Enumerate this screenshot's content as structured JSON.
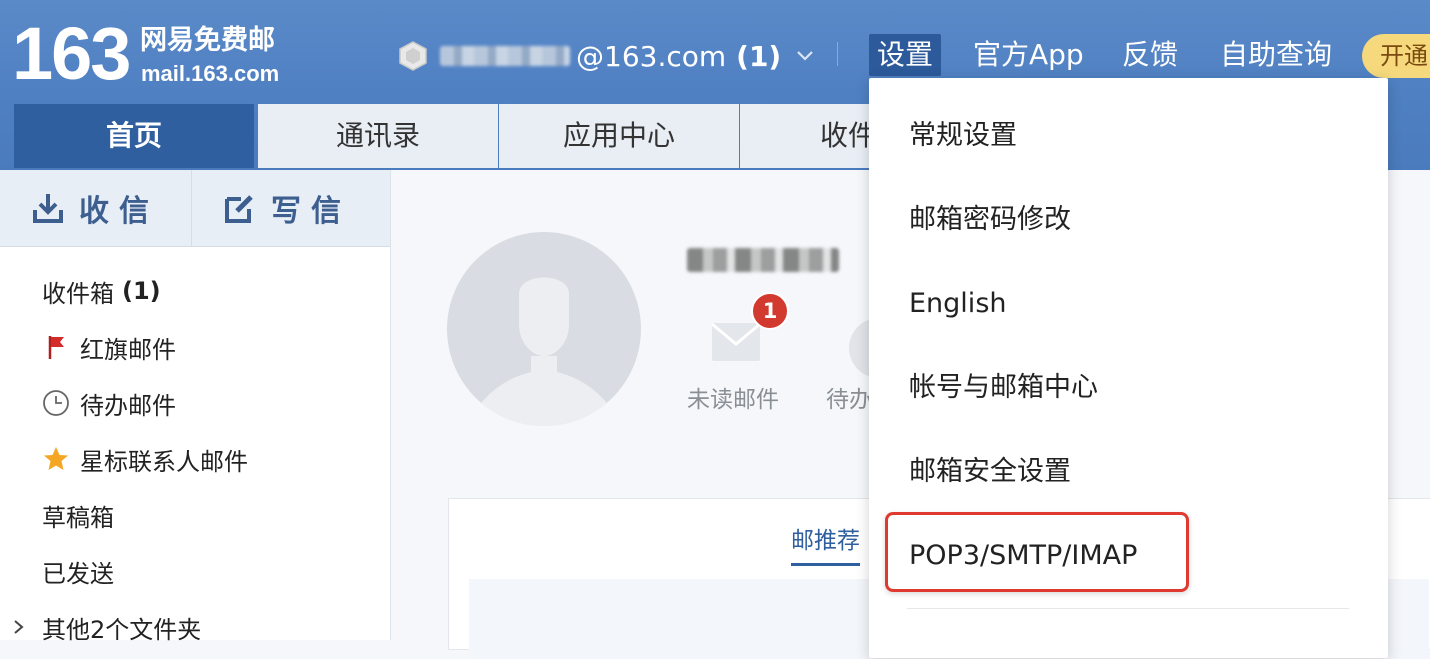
{
  "brand": {
    "logo_number": "163",
    "logo_cn": "网易免费邮",
    "logo_url": "mail.163.com"
  },
  "account": {
    "email_suffix": "@163.com",
    "unread": "(1)"
  },
  "top_nav": {
    "settings": "设置",
    "app": "官方App",
    "feedback": "反馈",
    "self_query": "自助查询",
    "vip": "开通"
  },
  "tabs": [
    {
      "label": "首页",
      "active": true
    },
    {
      "label": "通讯录",
      "active": false
    },
    {
      "label": "应用中心",
      "active": false
    },
    {
      "label": "收件",
      "active": false
    }
  ],
  "actions": {
    "receive": "收信",
    "write": "写信"
  },
  "folders": {
    "inbox": {
      "label": "收件箱",
      "count": "(1)"
    },
    "flagged": "红旗邮件",
    "todo": "待办邮件",
    "starred": "星标联系人邮件",
    "drafts": "草稿箱",
    "sent": "已发送",
    "other": "其他2个文件夹"
  },
  "profile": {
    "unread_badge": "1",
    "unread_label": "未读邮件",
    "todo_label": "待办"
  },
  "recommend": {
    "tab": "邮推荐"
  },
  "settings_menu": {
    "items": [
      "常规设置",
      "邮箱密码修改",
      "English",
      "帐号与邮箱中心",
      "邮箱安全设置",
      "POP3/SMTP/IMAP"
    ],
    "highlighted_index": 5
  },
  "colors": {
    "header_blue": "#4f80c2",
    "active_tab": "#2f5f9f",
    "badge_red": "#d33a2f",
    "highlight_red": "#e0392f",
    "vip_yellow": "#f6d97c"
  }
}
